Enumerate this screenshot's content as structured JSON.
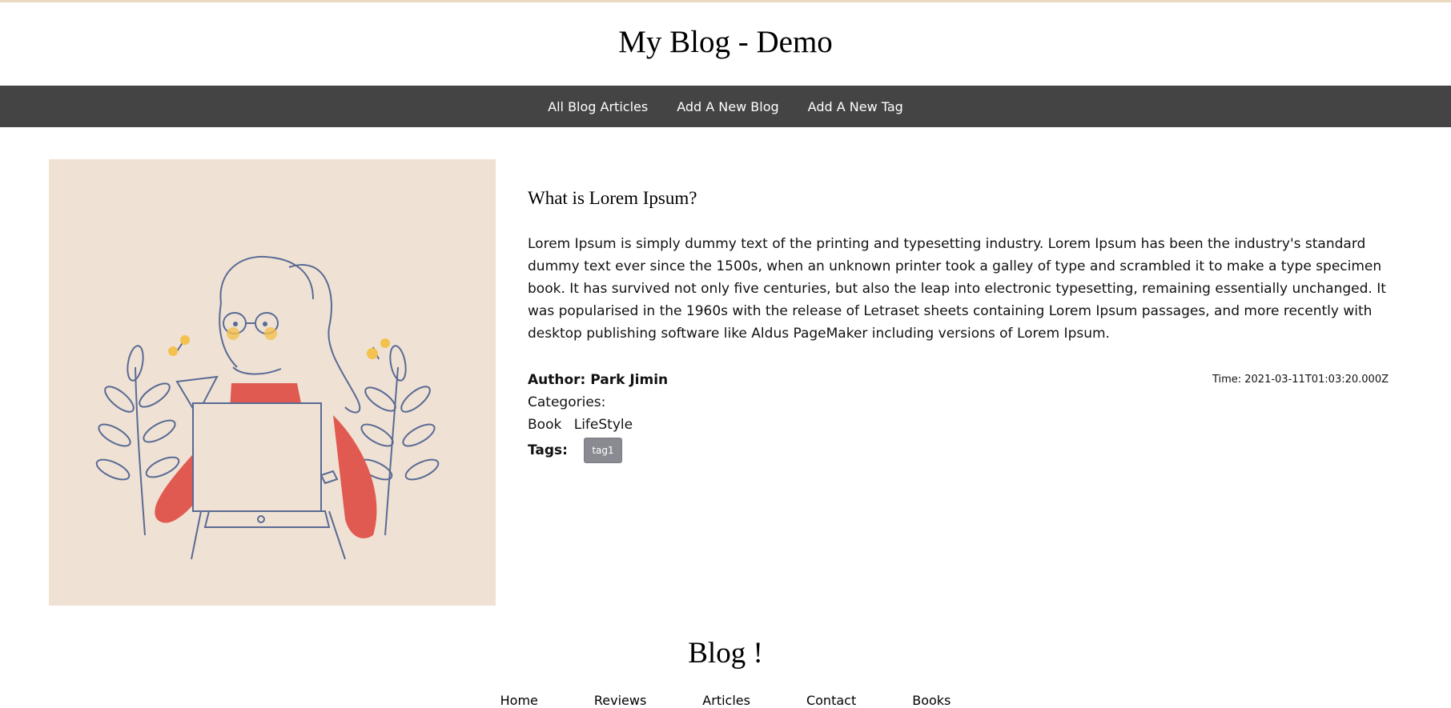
{
  "site": {
    "title": "My Blog - Demo"
  },
  "nav": {
    "items": [
      {
        "label": "All Blog Articles"
      },
      {
        "label": "Add A New Blog"
      },
      {
        "label": "Add A New Tag"
      }
    ]
  },
  "hero": {
    "icon": "girl-reading-illustration"
  },
  "article": {
    "title": "What is Lorem Ipsum?",
    "body": "Lorem Ipsum is simply dummy text of the printing and typesetting industry. Lorem Ipsum has been the industry's standard dummy text ever since the 1500s, when an unknown printer took a galley of type and scrambled it to make a type specimen book. It has survived not only five centuries, but also the leap into electronic typesetting, remaining essentially unchanged. It was popularised in the 1960s with the release of Letraset sheets containing Lorem Ipsum passages, and more recently with desktop publishing software like Aldus PageMaker including versions of Lorem Ipsum.",
    "author": "Author: Park Jimin",
    "time": "Time: 2021-03-11T01:03:20.000Z",
    "categories_label": "Categories:",
    "categories": [
      "Book",
      "LifeStyle"
    ],
    "tags_label": "Tags:",
    "tags": [
      "tag1"
    ]
  },
  "footer": {
    "title": "Blog !",
    "links": [
      "Home",
      "Reviews",
      "Articles",
      "Contact",
      "Books"
    ]
  },
  "colors": {
    "navbar": "#444444",
    "hero_bg": "#efe2d4",
    "tag_badge": "#8a8b92",
    "accent_red": "#e05a52",
    "accent_yellow": "#f2c14e",
    "line_blue": "#5a6a94"
  }
}
